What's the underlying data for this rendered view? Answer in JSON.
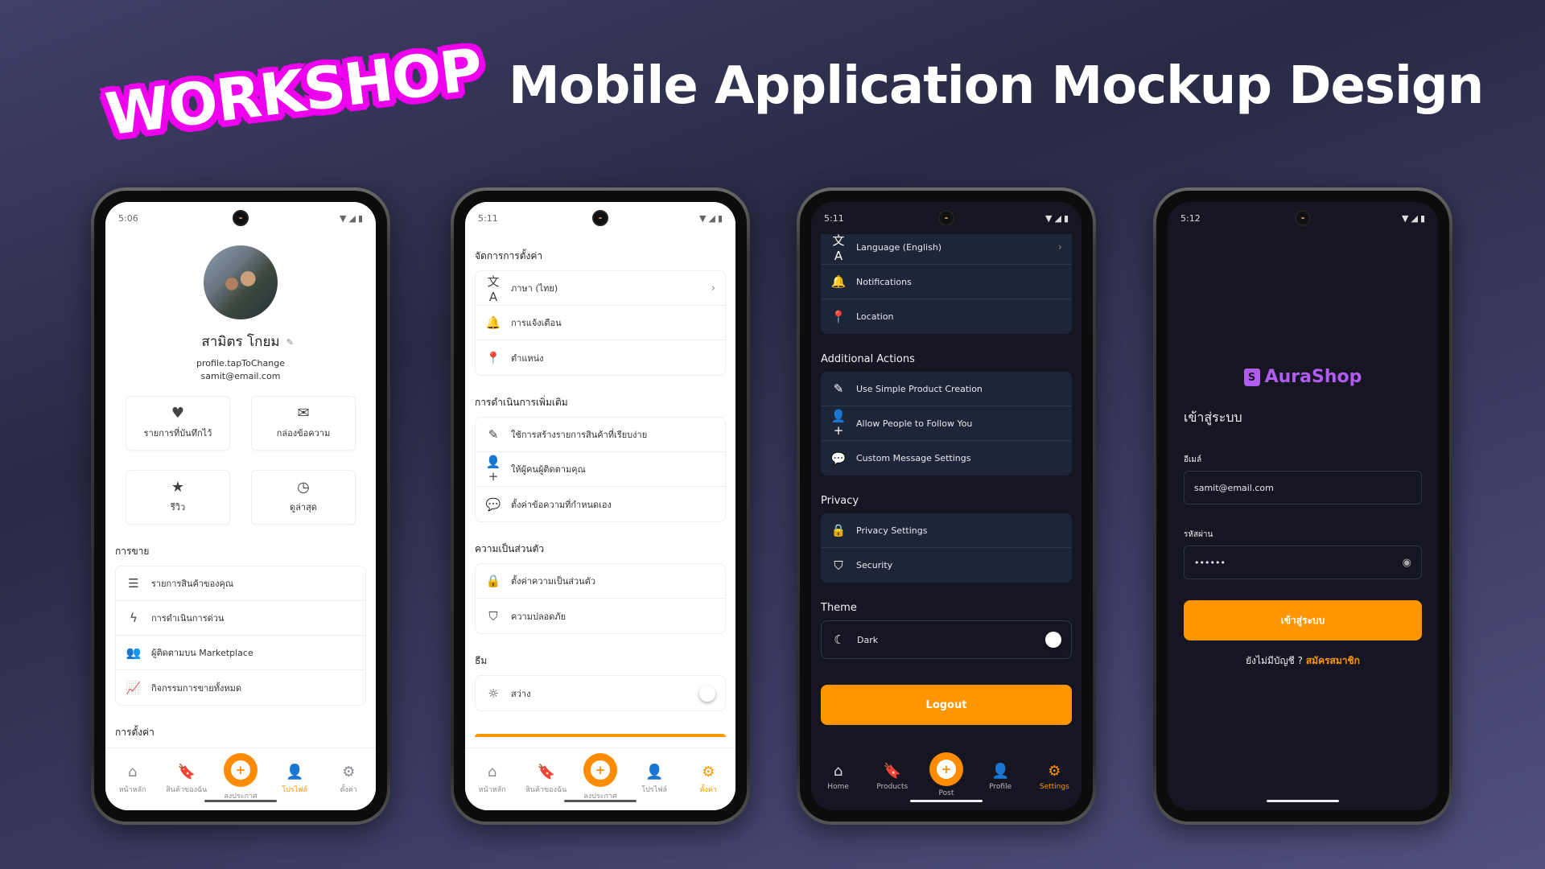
{
  "banner": {
    "badge": "WORKSHOP",
    "title": "Mobile Application Mockup Design"
  },
  "colors": {
    "accent": "#ff9500",
    "badge_magenta": "#ee00ee",
    "brand_purple": "#b05cf0",
    "dark_bg": "#161623",
    "dark_card": "#1c2638"
  },
  "phone1": {
    "time": "5:06",
    "profile": {
      "name": "สามิตร โกยม",
      "tap_to_change": "profile.tapToChange",
      "email": "samit@email.com"
    },
    "tiles": [
      {
        "icon": "heart-icon",
        "glyph": "♥",
        "label": "รายการที่บันทึกไว้"
      },
      {
        "icon": "envelope-icon",
        "glyph": "✉",
        "label": "กล่องข้อความ"
      },
      {
        "icon": "star-icon",
        "glyph": "★",
        "label": "รีวิว"
      },
      {
        "icon": "clock-icon",
        "glyph": "◷",
        "label": "ดูล่าสุด"
      }
    ],
    "selling_title": "การขาย",
    "selling_items": [
      {
        "icon": "list-icon",
        "glyph": "☰",
        "label": "รายการสินค้าของคุณ"
      },
      {
        "icon": "bolt-icon",
        "glyph": "ϟ",
        "label": "การดำเนินการด่วน"
      },
      {
        "icon": "users-icon",
        "glyph": "👥",
        "label": "ผู้ติดตามบน Marketplace"
      },
      {
        "icon": "chart-line-icon",
        "glyph": "📈",
        "label": "กิจกรรมการขายทั้งหมด"
      }
    ],
    "next_section_partial": "การตั้งค่า",
    "nav": [
      {
        "label": "หน้าหลัก",
        "icon": "home-icon",
        "glyph": "⌂"
      },
      {
        "label": "สินค้าของฉัน",
        "icon": "bookmark-icon",
        "glyph": "🔖"
      },
      {
        "label": "ลงประกาศ",
        "icon": "plus-icon",
        "glyph": "+"
      },
      {
        "label": "โปรไฟล์",
        "icon": "person-icon",
        "glyph": "👤"
      },
      {
        "label": "ตั้งค่า",
        "icon": "gear-icon",
        "glyph": "⚙"
      }
    ],
    "active_nav": "โปรไฟล์"
  },
  "phone2": {
    "time": "5:11",
    "sections": [
      {
        "title": "จัดการการตั้งค่า",
        "items": [
          {
            "icon": "translate-icon",
            "glyph": "文A",
            "label": "ภาษา (ไทย)",
            "chevron": true
          },
          {
            "icon": "bell-icon",
            "glyph": "🔔",
            "label": "การแจ้งเตือน"
          },
          {
            "icon": "map-pin-icon",
            "glyph": "📍",
            "label": "ตำแหน่ง"
          }
        ]
      },
      {
        "title": "การดำเนินการเพิ่มเติม",
        "items": [
          {
            "icon": "edit-icon",
            "glyph": "✎",
            "label": "ใช้การสร้างรายการสินค้าที่เรียบง่าย"
          },
          {
            "icon": "user-plus-icon",
            "glyph": "👤+",
            "label": "ให้ผู้คนผู้ติดตามคุณ"
          },
          {
            "icon": "chat-bubble-icon",
            "glyph": "💬",
            "label": "ตั้งค่าข้อความที่กำหนดเอง"
          }
        ]
      },
      {
        "title": "ความเป็นส่วนตัว",
        "items": [
          {
            "icon": "lock-icon",
            "glyph": "🔒",
            "label": "ตั้งค่าความเป็นส่วนตัว"
          },
          {
            "icon": "shield-icon",
            "glyph": "⛉",
            "label": "ความปลอดภัย"
          }
        ]
      }
    ],
    "theme_title": "ธีม",
    "theme_label": "สว่าง",
    "theme_dark_enabled": false,
    "nav": [
      {
        "label": "หน้าหลัก",
        "icon": "home-icon",
        "glyph": "⌂"
      },
      {
        "label": "สินค้าของฉัน",
        "icon": "bookmark-icon",
        "glyph": "🔖"
      },
      {
        "label": "ลงประกาศ",
        "icon": "plus-icon",
        "glyph": "+"
      },
      {
        "label": "โปรไฟล์",
        "icon": "person-icon",
        "glyph": "👤"
      },
      {
        "label": "ตั้งค่า",
        "icon": "gear-icon",
        "glyph": "⚙"
      }
    ],
    "active_nav": "ตั้งค่า"
  },
  "phone3": {
    "time": "5:11",
    "sections": [
      {
        "title": "",
        "items": [
          {
            "icon": "translate-icon",
            "glyph": "文A",
            "label": "Language (English)",
            "chevron": true
          },
          {
            "icon": "bell-icon",
            "glyph": "🔔",
            "label": "Notifications"
          },
          {
            "icon": "map-pin-icon",
            "glyph": "📍",
            "label": "Location"
          }
        ]
      },
      {
        "title": "Additional Actions",
        "items": [
          {
            "icon": "edit-icon",
            "glyph": "✎",
            "label": "Use Simple Product Creation"
          },
          {
            "icon": "user-plus-icon",
            "glyph": "👤+",
            "label": "Allow People to Follow You"
          },
          {
            "icon": "chat-bubble-icon",
            "glyph": "💬",
            "label": "Custom Message Settings"
          }
        ]
      },
      {
        "title": "Privacy",
        "items": [
          {
            "icon": "lock-icon",
            "glyph": "🔒",
            "label": "Privacy Settings"
          },
          {
            "icon": "shield-icon",
            "glyph": "⛉",
            "label": "Security"
          }
        ]
      }
    ],
    "theme_title": "Theme",
    "theme_label": "Dark",
    "theme_dark_enabled": true,
    "logout_label": "Logout",
    "nav": [
      {
        "label": "Home",
        "icon": "home-icon",
        "glyph": "⌂"
      },
      {
        "label": "Products",
        "icon": "bookmark-icon",
        "glyph": "🔖"
      },
      {
        "label": "Post",
        "icon": "plus-icon",
        "glyph": "+"
      },
      {
        "label": "Profile",
        "icon": "person-icon",
        "glyph": "👤"
      },
      {
        "label": "Settings",
        "icon": "gear-icon",
        "glyph": "⚙"
      }
    ],
    "active_nav": "Settings"
  },
  "phone4": {
    "time": "5:12",
    "brand": "AuraShop",
    "brand_glyph": "S",
    "title": "เข้าสู่ระบบ",
    "email_label": "อีเมล์",
    "email_value": "samit@email.com",
    "password_label": "รหัสผ่าน",
    "password_value": "••••••",
    "login_button": "เข้าสู่ระบบ",
    "no_account": "ยังไม่มีบัญชี ?",
    "signup_link": "สมัครสมาชิก"
  }
}
